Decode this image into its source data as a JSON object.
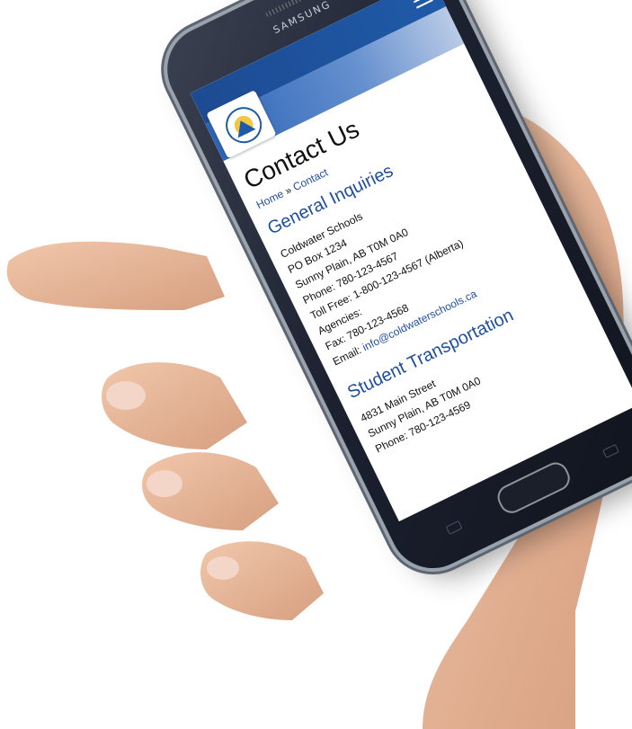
{
  "phone": {
    "brand": "SAMSUNG"
  },
  "page": {
    "title": "Contact Us",
    "breadcrumb": {
      "home": "Home",
      "separator": " » ",
      "current": "Contact"
    },
    "general": {
      "heading": "General Inquiries",
      "lines": [
        "Coldwater Schools",
        "PO Box 1234",
        "Sunny Plain, AB T0M 0A0",
        "Phone: 780-123-4567",
        "Toll Free: 1-800-123-4567 (Alberta)",
        "Agencies:",
        "Fax: 780-123-4568"
      ],
      "email_label": "Email: ",
      "email_value": "info@coldwaterschools.ca"
    },
    "transportation": {
      "heading": "Student Transportation",
      "lines": [
        "4831 Main Street",
        "Sunny Plain, AB T0M 0A0",
        "Phone: 780-123-4569"
      ]
    }
  },
  "icons": {
    "menu": "hamburger-menu-icon",
    "logo": "district-logo"
  },
  "colors": {
    "header_blue": "#1f5aa8",
    "link_blue": "#1f4fa0",
    "skin": "#e8b99c"
  }
}
